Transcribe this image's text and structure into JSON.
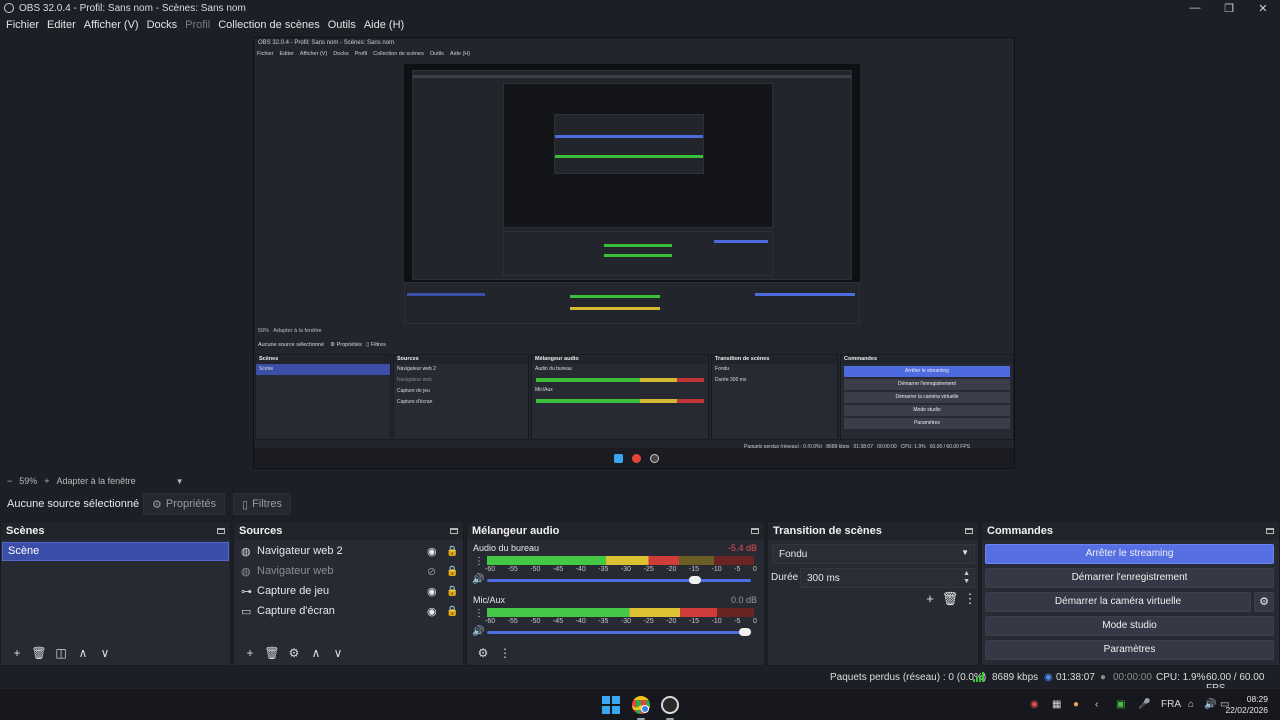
{
  "window": {
    "title": "OBS 32.0.4 - Profil: Sans nom - Scènes: Sans nom",
    "controls": [
      "—",
      "❐",
      "✕"
    ]
  },
  "menu": [
    "Fichier",
    "Editer",
    "Afficher (V)",
    "Docks",
    "Profil",
    "Collection de scènes",
    "Outils",
    "Aide (H)"
  ],
  "zoom": {
    "minus": "−",
    "value": "59%",
    "plus": "+",
    "fit": "Adapter à la fenêtre"
  },
  "source_toolbar": {
    "no_source": "Aucune source sélectionné",
    "properties": "Propriétés",
    "filters": "Filtres"
  },
  "scenes": {
    "title": "Scènes",
    "items": [
      "Scène"
    ],
    "toolbar": [
      "+",
      "🗑",
      "◫",
      "∧",
      "∨"
    ]
  },
  "sources": {
    "title": "Sources",
    "items": [
      {
        "label": "Navigateur web 2",
        "icon": "globe-icon",
        "visible": true
      },
      {
        "label": "Navigateur web",
        "icon": "globe-icon",
        "visible": false
      },
      {
        "label": "Capture de jeu",
        "icon": "gamepad-icon",
        "visible": true
      },
      {
        "label": "Capture d'écran",
        "icon": "monitor-icon",
        "visible": true
      }
    ],
    "toolbar": [
      "+",
      "🗑",
      "⚙",
      "∧",
      "∨"
    ]
  },
  "mixer": {
    "title": "Mélangeur audio",
    "channels": [
      {
        "name": "Audio du bureau",
        "db": "-5.4 dB",
        "level": 0.72,
        "volume": 0.8
      },
      {
        "name": "Mic/Aux",
        "db": "0.0 dB",
        "level": 0.86,
        "volume": 1.0
      }
    ],
    "scale": [
      "-60",
      "-55",
      "-50",
      "-45",
      "-40",
      "-35",
      "-30",
      "-25",
      "-20",
      "-15",
      "-10",
      "-5",
      "0"
    ]
  },
  "transitions": {
    "title": "Transition de scènes",
    "selected": "Fondu",
    "duration_label": "Durée",
    "duration_value": "300 ms"
  },
  "controls": {
    "title": "Commandes",
    "stop_streaming": "Arrêter le streaming",
    "start_recording": "Démarrer l'enregistrement",
    "start_virtualcam": "Démarrer la caméra virtuelle",
    "studio_mode": "Mode studio",
    "settings": "Paramètres"
  },
  "status": {
    "dropped_frames": "Paquets perdus (réseau) : 0 (0.0%)",
    "bitrate": "8689 kbps",
    "stream_time": "01:38:07",
    "rec_time": "00:00:00",
    "cpu": "CPU: 1.9%",
    "fps": "60.00 / 60.00 FPS"
  },
  "taskbar": {
    "language": "FRA",
    "time": "08:29",
    "date": "22/02/2026"
  },
  "colors": {
    "accent": "#5670e4",
    "scene_selected": "#3b4fa8",
    "meter_green": "#45c845",
    "meter_yellow": "#dcc132",
    "meter_red": "#d03c3c"
  }
}
